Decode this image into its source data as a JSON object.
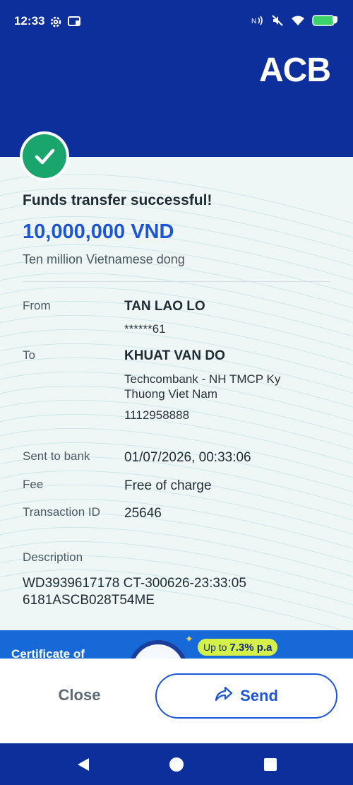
{
  "status_bar": {
    "time": "12:33",
    "left_icons": [
      "gear-icon",
      "screen-share-icon"
    ],
    "right_icons": [
      "nfc-icon",
      "mute-icon",
      "wifi-icon",
      "battery-icon"
    ]
  },
  "header": {
    "brand": "ACB",
    "background_color": "#0d2f9c"
  },
  "receipt": {
    "title": "Funds transfer successful!",
    "amount": "10,000,000 VND",
    "amount_words": "Ten million Vietnamese dong",
    "from": {
      "label": "From",
      "name": "TAN LAO LO",
      "account": "******61"
    },
    "to": {
      "label": "To",
      "name": "KHUAT VAN DO",
      "bank_line1": "Techcombank - NH TMCP Ky",
      "bank_line2": "Thuong Viet Nam",
      "account": "1112958888"
    },
    "sent_to_bank": {
      "label": "Sent to bank",
      "value": "01/07/2026, 00:33:06"
    },
    "fee": {
      "label": "Fee",
      "value": "Free of charge"
    },
    "transaction_id": {
      "label": "Transaction ID",
      "value": "25646"
    },
    "description": {
      "label": "Description",
      "line1": "WD3939617178 CT-300626-23:33:05",
      "line2": "6181ASCB028T54ME"
    }
  },
  "promo": {
    "text": "Certificate of",
    "rate_prefix": "Up to",
    "rate_value": "7.3% p.a"
  },
  "actions": {
    "close_label": "Close",
    "send_label": "Send"
  },
  "colors": {
    "accent": "#1c55d6",
    "success": "#1aa56c",
    "brand_blue": "#0d2f9c"
  }
}
